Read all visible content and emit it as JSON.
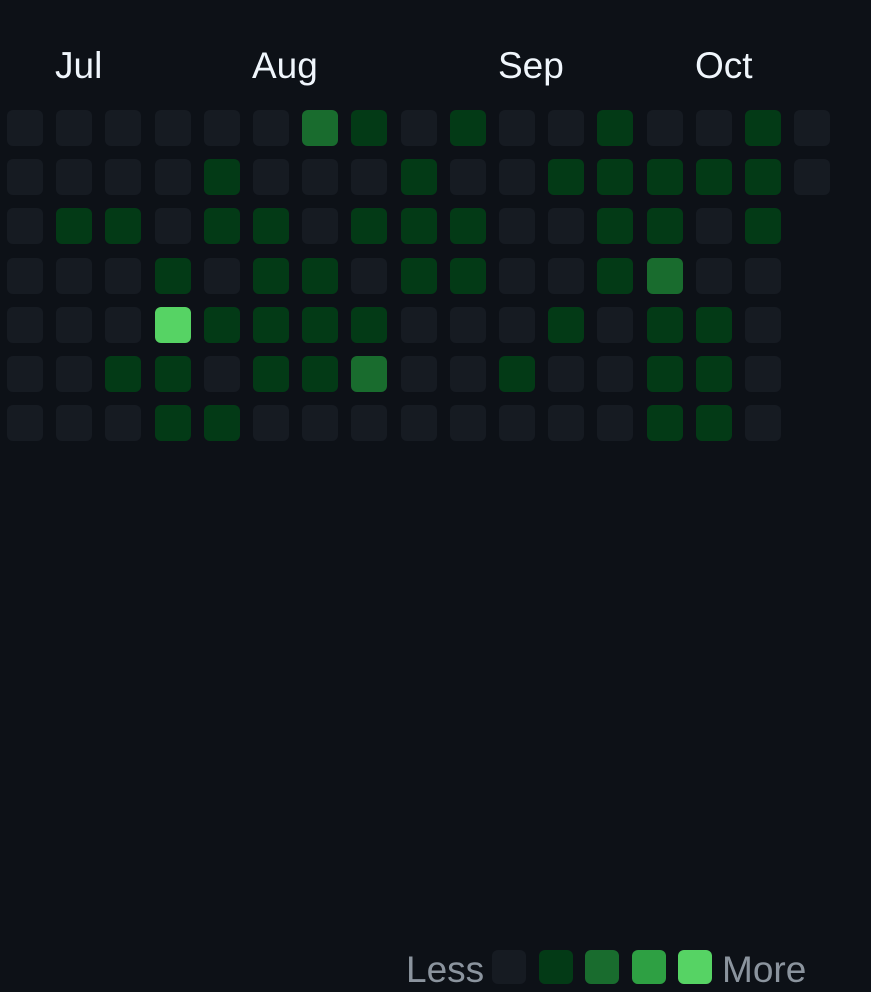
{
  "months": [
    {
      "label": "Jul",
      "col": 1
    },
    {
      "label": "Aug",
      "col": 5
    },
    {
      "label": "Sep",
      "col": 10
    },
    {
      "label": "Oct",
      "col": 14
    }
  ],
  "colors": [
    "#161b22",
    "#033a16",
    "#196c2e",
    "#2ea043",
    "#56d364"
  ],
  "grid": [
    [
      0,
      0,
      0,
      0,
      0,
      0,
      2,
      1,
      0,
      1,
      0,
      0,
      1,
      0,
      0,
      1,
      0
    ],
    [
      0,
      0,
      0,
      0,
      1,
      0,
      0,
      0,
      1,
      0,
      0,
      1,
      1,
      1,
      1,
      1,
      0
    ],
    [
      0,
      1,
      1,
      0,
      1,
      1,
      0,
      1,
      1,
      1,
      0,
      0,
      1,
      1,
      0,
      1,
      null
    ],
    [
      0,
      0,
      0,
      1,
      0,
      1,
      1,
      0,
      1,
      1,
      0,
      0,
      1,
      2,
      0,
      0,
      null
    ],
    [
      0,
      0,
      0,
      4,
      1,
      1,
      1,
      1,
      0,
      0,
      0,
      1,
      0,
      1,
      1,
      0,
      null
    ],
    [
      0,
      0,
      1,
      1,
      0,
      1,
      1,
      2,
      0,
      0,
      1,
      0,
      0,
      1,
      1,
      0,
      null
    ],
    [
      0,
      0,
      0,
      1,
      1,
      0,
      0,
      0,
      0,
      0,
      0,
      0,
      0,
      1,
      1,
      0,
      null
    ]
  ],
  "legend": {
    "less_label": "Less",
    "more_label": "More",
    "levels": [
      0,
      1,
      2,
      3,
      4
    ]
  }
}
